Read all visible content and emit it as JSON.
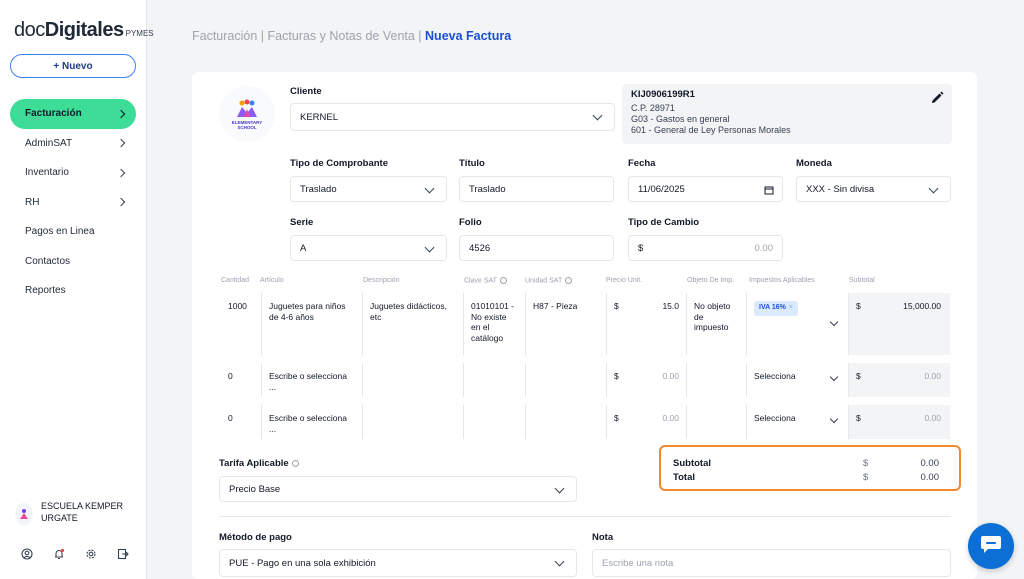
{
  "sidebar": {
    "logo": {
      "part1": "doc",
      "part2": "Digitales",
      "part3": "PYMES"
    },
    "new_button": "+ Nuevo",
    "items": [
      {
        "label": "Facturación",
        "active": true,
        "has_chevron": true
      },
      {
        "label": "AdminSAT",
        "has_chevron": true
      },
      {
        "label": "Inventario",
        "has_chevron": true
      },
      {
        "label": "RH",
        "has_chevron": true
      },
      {
        "label": "Pagos en Linea",
        "has_chevron": false
      },
      {
        "label": "Contactos",
        "has_chevron": false
      },
      {
        "label": "Reportes",
        "has_chevron": false
      }
    ],
    "user_name": "ESCUELA KEMPER URGATE",
    "bottom_icons": [
      "user-circle-icon",
      "bell-icon",
      "gear-icon",
      "logout-icon"
    ]
  },
  "breadcrumb": {
    "part1": "Facturación",
    "sep1": " | ",
    "part2": "Facturas y Notas de Venta",
    "sep2": " | ",
    "current": "Nueva Factura"
  },
  "client_logo": {
    "text1": "ELEMENTARY",
    "text2": "SCHOOL"
  },
  "form": {
    "cliente": {
      "label": "Cliente",
      "value": "KERNEL"
    },
    "rfc_box": {
      "rfc": "KIJ0906199R1",
      "cp": "C.P. 28971",
      "uso": "G03 - Gastos en general",
      "regimen": "601 - General de Ley Personas Morales"
    },
    "tipo_comprobante": {
      "label": "Tipo de Comprobante",
      "value": "Traslado"
    },
    "titulo": {
      "label": "Título",
      "value": "Traslado"
    },
    "fecha": {
      "label": "Fecha",
      "value": "11/06/2025"
    },
    "moneda": {
      "label": "Moneda",
      "value": "XXX - Sin divisa"
    },
    "serie": {
      "label": "Serie",
      "value": "A"
    },
    "folio": {
      "label": "Folio",
      "value": "4526"
    },
    "tipo_cambio": {
      "label": "Tipo de Cambio",
      "currency": "$",
      "value": "0.00"
    }
  },
  "table": {
    "headers": [
      "Cantidad",
      "Artículo",
      "Descripción",
      "Clave SAT",
      "Unidad SAT",
      "Precio Unit.",
      "Objeto De Imp.",
      "Impuestos Aplicables",
      "Subtotal"
    ],
    "row1": {
      "cantidad": "1000",
      "articulo": "Juguetes para niños de 4-6 años",
      "descripcion": "Juguetes didácticos, etc",
      "clave": "01010101 - No existe en el catálogo",
      "unidad": "H87 - Pieza",
      "precio_cur": "$",
      "precio": "15.0",
      "objeto": "No objeto de impuesto",
      "impuesto_badge": "IVA 16%",
      "subtotal_cur": "$",
      "subtotal": "15,000.00"
    },
    "empty_row": {
      "cantidad": "0",
      "articulo_placeholder": "Escribe o selecciona ...",
      "precio_cur": "$",
      "precio": "0.00",
      "impuesto_placeholder": "Selecciona",
      "subtotal_cur": "$",
      "subtotal": "0.00"
    }
  },
  "tarifa": {
    "label": "Tarifa Aplicable",
    "value": "Precio Base"
  },
  "totals": {
    "subtotal_label": "Subtotal",
    "total_label": "Total",
    "cur": "$",
    "subtotal": "0.00",
    "total": "0.00",
    "highlight_color": "#f28a2c"
  },
  "metodo_pago": {
    "label": "Método de pago",
    "value": "PUE - Pago en una sola exhibición"
  },
  "nota": {
    "label": "Nota",
    "placeholder": "Escribe una nota"
  },
  "colors": {
    "accent_green": "#3ddc97",
    "accent_blue": "#1d4ed8",
    "chat_blue": "#0b6fd6"
  }
}
